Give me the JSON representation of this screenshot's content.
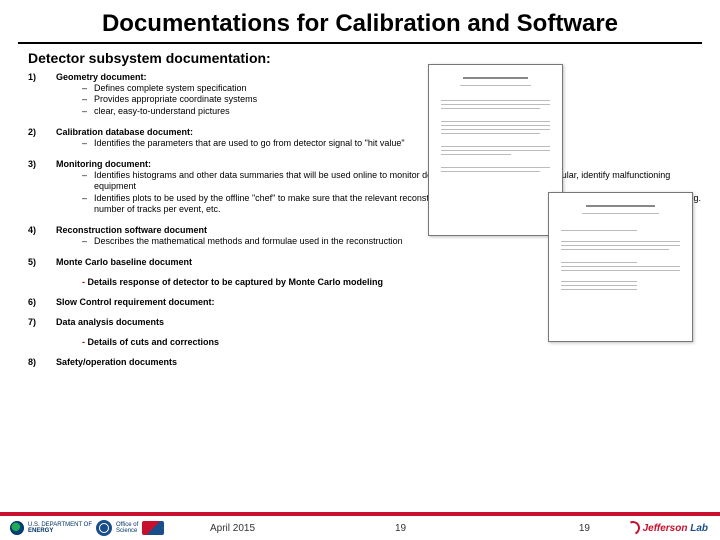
{
  "title": "Documentations for Calibration and Software",
  "subtitle": "Detector subsystem documentation:",
  "items": [
    {
      "num": "1)",
      "title": "Geometry document:",
      "bullets": [
        "Defines complete system specification",
        "Provides appropriate coordinate systems",
        "clear, easy-to-understand pictures"
      ]
    },
    {
      "num": "2)",
      "title": "Calibration database document:",
      "bullets": [
        "Identifies the parameters that are used to go from detector signal to \"hit value\""
      ]
    },
    {
      "num": "3)",
      "title": "Monitoring document:",
      "bullets": [
        "Identifies histograms and other data summaries that will be used online to monitor detector performance and, in particular, identify malfunctioning equipment",
        "Identifies plots to be used by the offline \"chef\" to make sure that the relevant reconstruction code (e.g. tracking, shower-finding, etc.) is working right, e.g. number of tracks per event, etc."
      ]
    },
    {
      "num": "4)",
      "title": "Reconstruction software document",
      "bullets": [
        "Describes the mathematical methods and formulae used in the reconstruction"
      ]
    },
    {
      "num": "5)",
      "title": "Monte Carlo baseline document",
      "bullets": [],
      "note": "Details response of detector to be captured by Monte Carlo modeling"
    },
    {
      "num": "6)",
      "title": "Slow Control requirement document:",
      "bullets": []
    },
    {
      "num": "7)",
      "title": "Data analysis documents",
      "bullets": [],
      "note": "Details of cuts and corrections"
    },
    {
      "num": "8)",
      "title": "Safety/operation documents",
      "bullets": []
    }
  ],
  "footer": {
    "doe_line1": "U.S. DEPARTMENT OF",
    "doe_line2": "ENERGY",
    "office1": "Office of",
    "office2": "Science",
    "date": "April 2015",
    "page_a": "19",
    "page_b": "19",
    "jlab_j": "Jefferson",
    "jlab_l": " Lab"
  }
}
